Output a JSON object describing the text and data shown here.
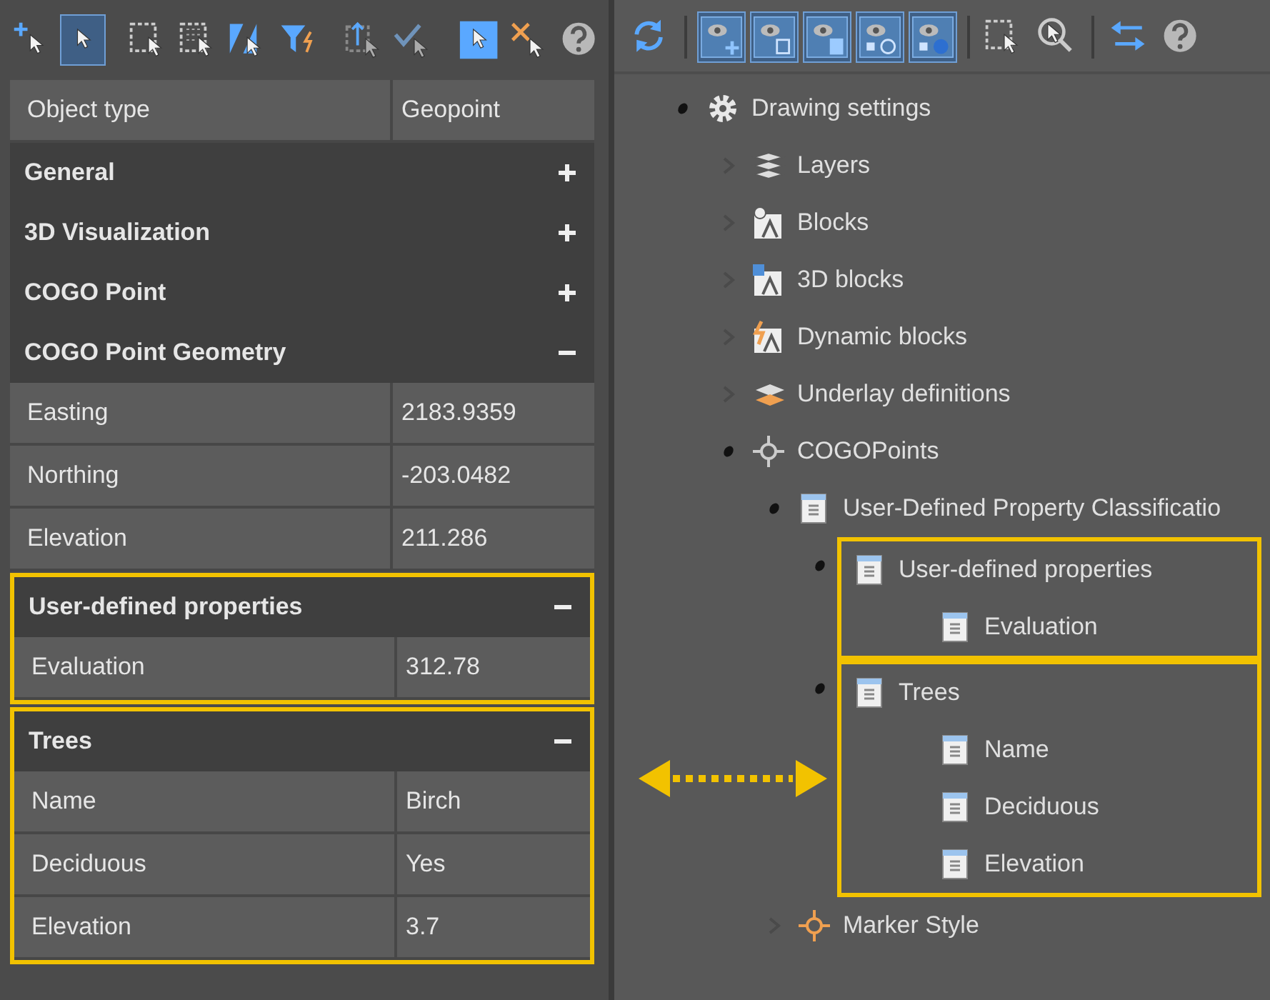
{
  "properties_panel": {
    "toolbar": [
      [
        {
          "kind": "add-select",
          "selected": false
        },
        {
          "kind": "select",
          "selected": true
        }
      ],
      [
        {
          "kind": "window-select",
          "selected": false
        },
        {
          "kind": "window-select-all",
          "selected": false
        },
        {
          "kind": "flip-select",
          "selected": false
        },
        {
          "kind": "filter",
          "selected": false
        }
      ],
      [
        {
          "kind": "move-up",
          "selected": false
        },
        {
          "kind": "check-select",
          "selected": false
        }
      ],
      [
        {
          "kind": "select-active",
          "selected": false
        },
        {
          "kind": "delete-select",
          "selected": false
        },
        {
          "kind": "help",
          "selected": false
        }
      ]
    ],
    "object_type": {
      "label": "Object type",
      "value": "Geopoint"
    },
    "sections": [
      {
        "title": "General",
        "expanded": false,
        "highlighted": false
      },
      {
        "title": "3D Visualization",
        "expanded": false,
        "highlighted": false
      },
      {
        "title": "COGO Point",
        "expanded": false,
        "highlighted": false
      },
      {
        "title": "COGO Point Geometry",
        "expanded": true,
        "highlighted": false,
        "rows": [
          {
            "label": "Easting",
            "value": "2183.9359"
          },
          {
            "label": "Northing",
            "value": "-203.0482"
          },
          {
            "label": "Elevation",
            "value": "211.286"
          }
        ]
      },
      {
        "title": "User-defined properties",
        "expanded": true,
        "highlighted": true,
        "rows": [
          {
            "label": "Evaluation",
            "value": "312.78"
          }
        ]
      },
      {
        "title": "Trees",
        "expanded": true,
        "highlighted": true,
        "rows": [
          {
            "label": "Name",
            "value": "Birch"
          },
          {
            "label": "Deciduous",
            "value": "Yes"
          },
          {
            "label": "Elevation",
            "value": "3.7"
          }
        ]
      }
    ]
  },
  "tree_panel": {
    "toolbar": [
      [
        {
          "kind": "refresh",
          "selected": false
        }
      ],
      [
        {
          "kind": "eye-add",
          "selected": true
        },
        {
          "kind": "eye-empty",
          "selected": true
        },
        {
          "kind": "eye-full",
          "selected": true
        },
        {
          "kind": "eye-partial",
          "selected": true
        },
        {
          "kind": "eye-sphere",
          "selected": true
        }
      ],
      [
        {
          "kind": "window-select",
          "selected": false
        },
        {
          "kind": "zoom",
          "selected": false
        }
      ],
      [
        {
          "kind": "swap",
          "selected": false
        },
        {
          "kind": "help",
          "selected": false
        }
      ]
    ],
    "tree": [
      {
        "label": "Drawing settings",
        "kind": "gear",
        "expanded": true,
        "children": [
          {
            "label": "Layers",
            "kind": "layers",
            "expanded": false
          },
          {
            "label": "Blocks",
            "kind": "block",
            "expanded": false
          },
          {
            "label": "3D blocks",
            "kind": "block-3d",
            "expanded": false
          },
          {
            "label": "Dynamic blocks",
            "kind": "block-dynamic",
            "expanded": false
          },
          {
            "label": "Underlay definitions",
            "kind": "underlay",
            "expanded": false
          },
          {
            "label": "COGOPoints",
            "kind": "point",
            "expanded": true,
            "children": [
              {
                "label": "User-Defined Property Classificatio",
                "kind": "table",
                "expanded": true,
                "children": [
                  {
                    "label": "User-defined properties",
                    "kind": "table",
                    "expanded": true,
                    "highlighted": true,
                    "children": [
                      {
                        "label": "Evaluation",
                        "kind": "table"
                      }
                    ]
                  },
                  {
                    "label": "Trees",
                    "kind": "table",
                    "expanded": true,
                    "highlighted": true,
                    "children": [
                      {
                        "label": "Name",
                        "kind": "table"
                      },
                      {
                        "label": "Deciduous",
                        "kind": "table"
                      },
                      {
                        "label": "Elevation",
                        "kind": "table"
                      }
                    ]
                  }
                ]
              },
              {
                "label": "Marker Style",
                "kind": "marker",
                "expanded": false
              }
            ]
          }
        ]
      }
    ]
  }
}
